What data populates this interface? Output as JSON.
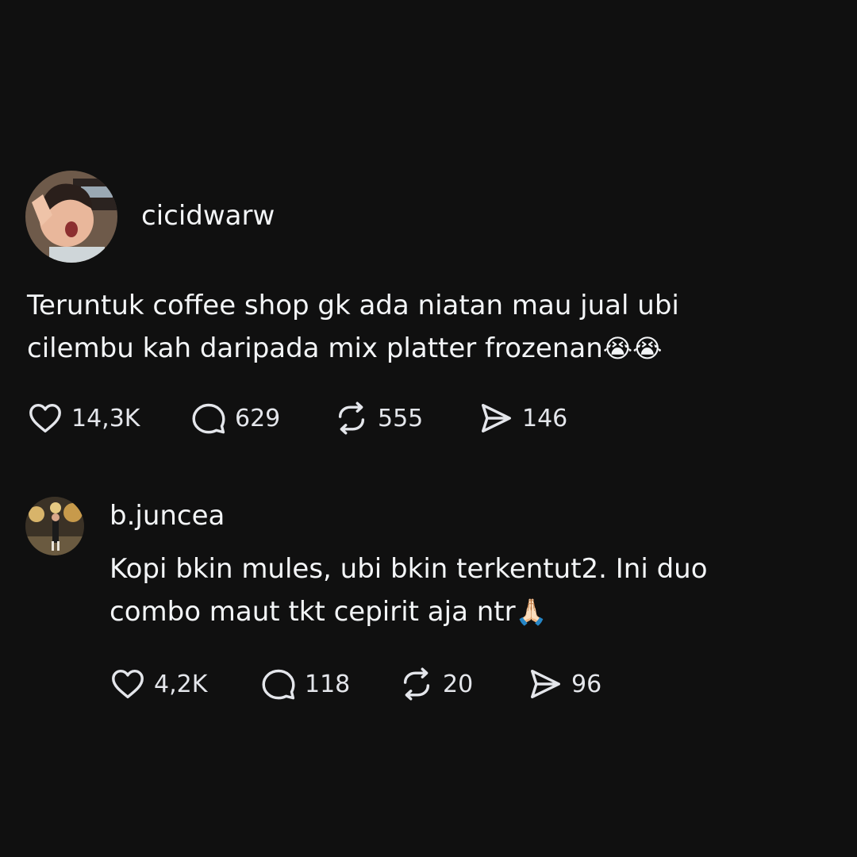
{
  "post": {
    "username": "cicidwarw",
    "text_line1": "Teruntuk coffee shop gk ada niatan mau jual ubi",
    "text_line2": "cilembu kah daripada mix platter frozenan",
    "text_emoji": "😭😭",
    "avatar_icon": "avatar-photo-child",
    "actions": {
      "likes": "14,3K",
      "comments": "629",
      "reposts": "555",
      "shares": "146"
    }
  },
  "reply": {
    "username": "b.juncea",
    "text_line1": "Kopi bkin mules, ubi bkin terkentut2. Ini duo",
    "text_line2": "combo maut tkt cepirit aja ntr",
    "text_emoji": "🙏🏻",
    "avatar_icon": "avatar-photo-person",
    "actions": {
      "likes": "4,2K",
      "comments": "118",
      "reposts": "20",
      "shares": "96"
    }
  },
  "colors": {
    "background": "#101010",
    "text": "#f3f5f7",
    "icon": "#e4e6eb"
  }
}
